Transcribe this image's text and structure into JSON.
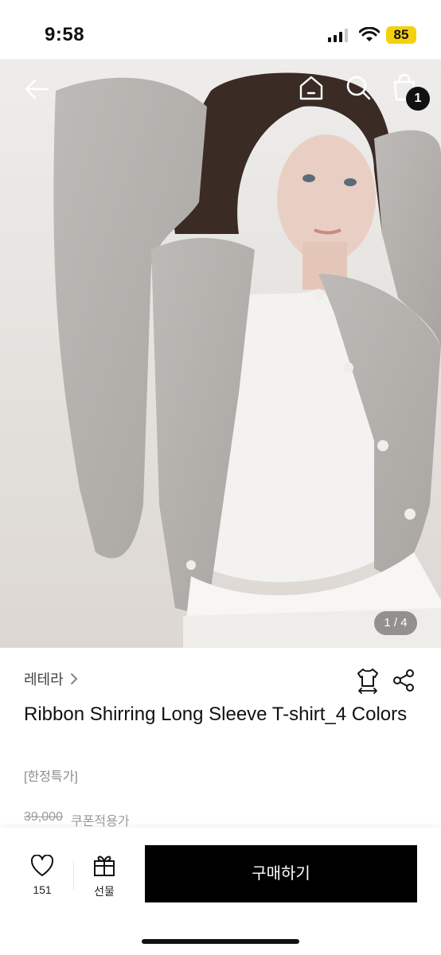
{
  "status": {
    "time": "9:58",
    "battery": "85"
  },
  "nav": {
    "cart_count": "1"
  },
  "gallery": {
    "indicator": "1 / 4"
  },
  "product": {
    "brand": "레테라",
    "title": "Ribbon Shirring Long Sleeve T-shirt_4 Colors",
    "promo_tag": "[한정특가]",
    "original_price": "39,000",
    "coupon_label": "쿠폰적용가"
  },
  "actions": {
    "like_count": "151",
    "gift_label": "선물",
    "buy_label": "구매하기"
  },
  "colors": {
    "accent": "#000000",
    "battery": "#f5d10d",
    "muted": "#8a8a8a"
  }
}
